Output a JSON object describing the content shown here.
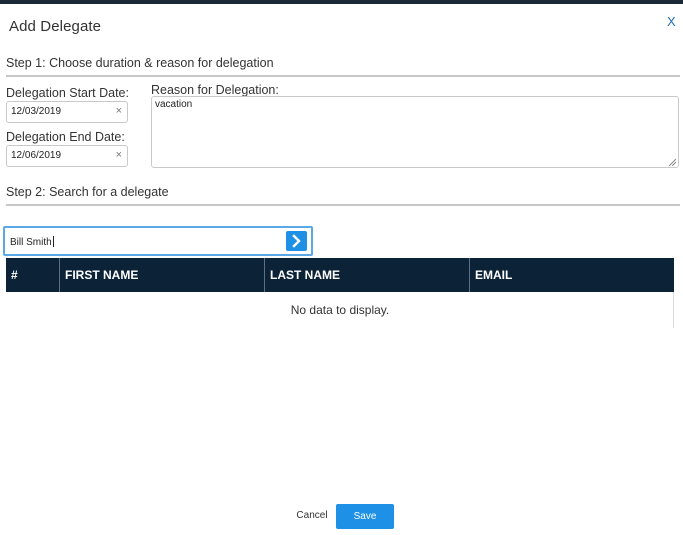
{
  "dialog": {
    "title": "Add Delegate",
    "close_label": "X"
  },
  "step1": {
    "heading": "Step 1: Choose duration & reason for delegation",
    "start_date": {
      "label": "Delegation Start Date:",
      "value": "12/03/2019",
      "clear_icon": "×"
    },
    "end_date": {
      "label": "Delegation End Date:",
      "value": "12/06/2019",
      "clear_icon": "×"
    },
    "reason": {
      "label": "Reason for Delegation:",
      "value": "vacation"
    }
  },
  "step2": {
    "heading": "Step 2: Search for a delegate",
    "search": {
      "value": "Bill Smith",
      "button_icon": "chevron-right-icon"
    },
    "grid": {
      "columns": [
        "#",
        "FIRST NAME",
        "LAST NAME",
        "EMAIL"
      ],
      "empty_text": "No data to display."
    }
  },
  "footer": {
    "cancel_label": "Cancel",
    "save_label": "Save"
  },
  "colors": {
    "accent": "#1e90e6",
    "grid_header": "#0b2237",
    "close": "#1f6fb5"
  }
}
